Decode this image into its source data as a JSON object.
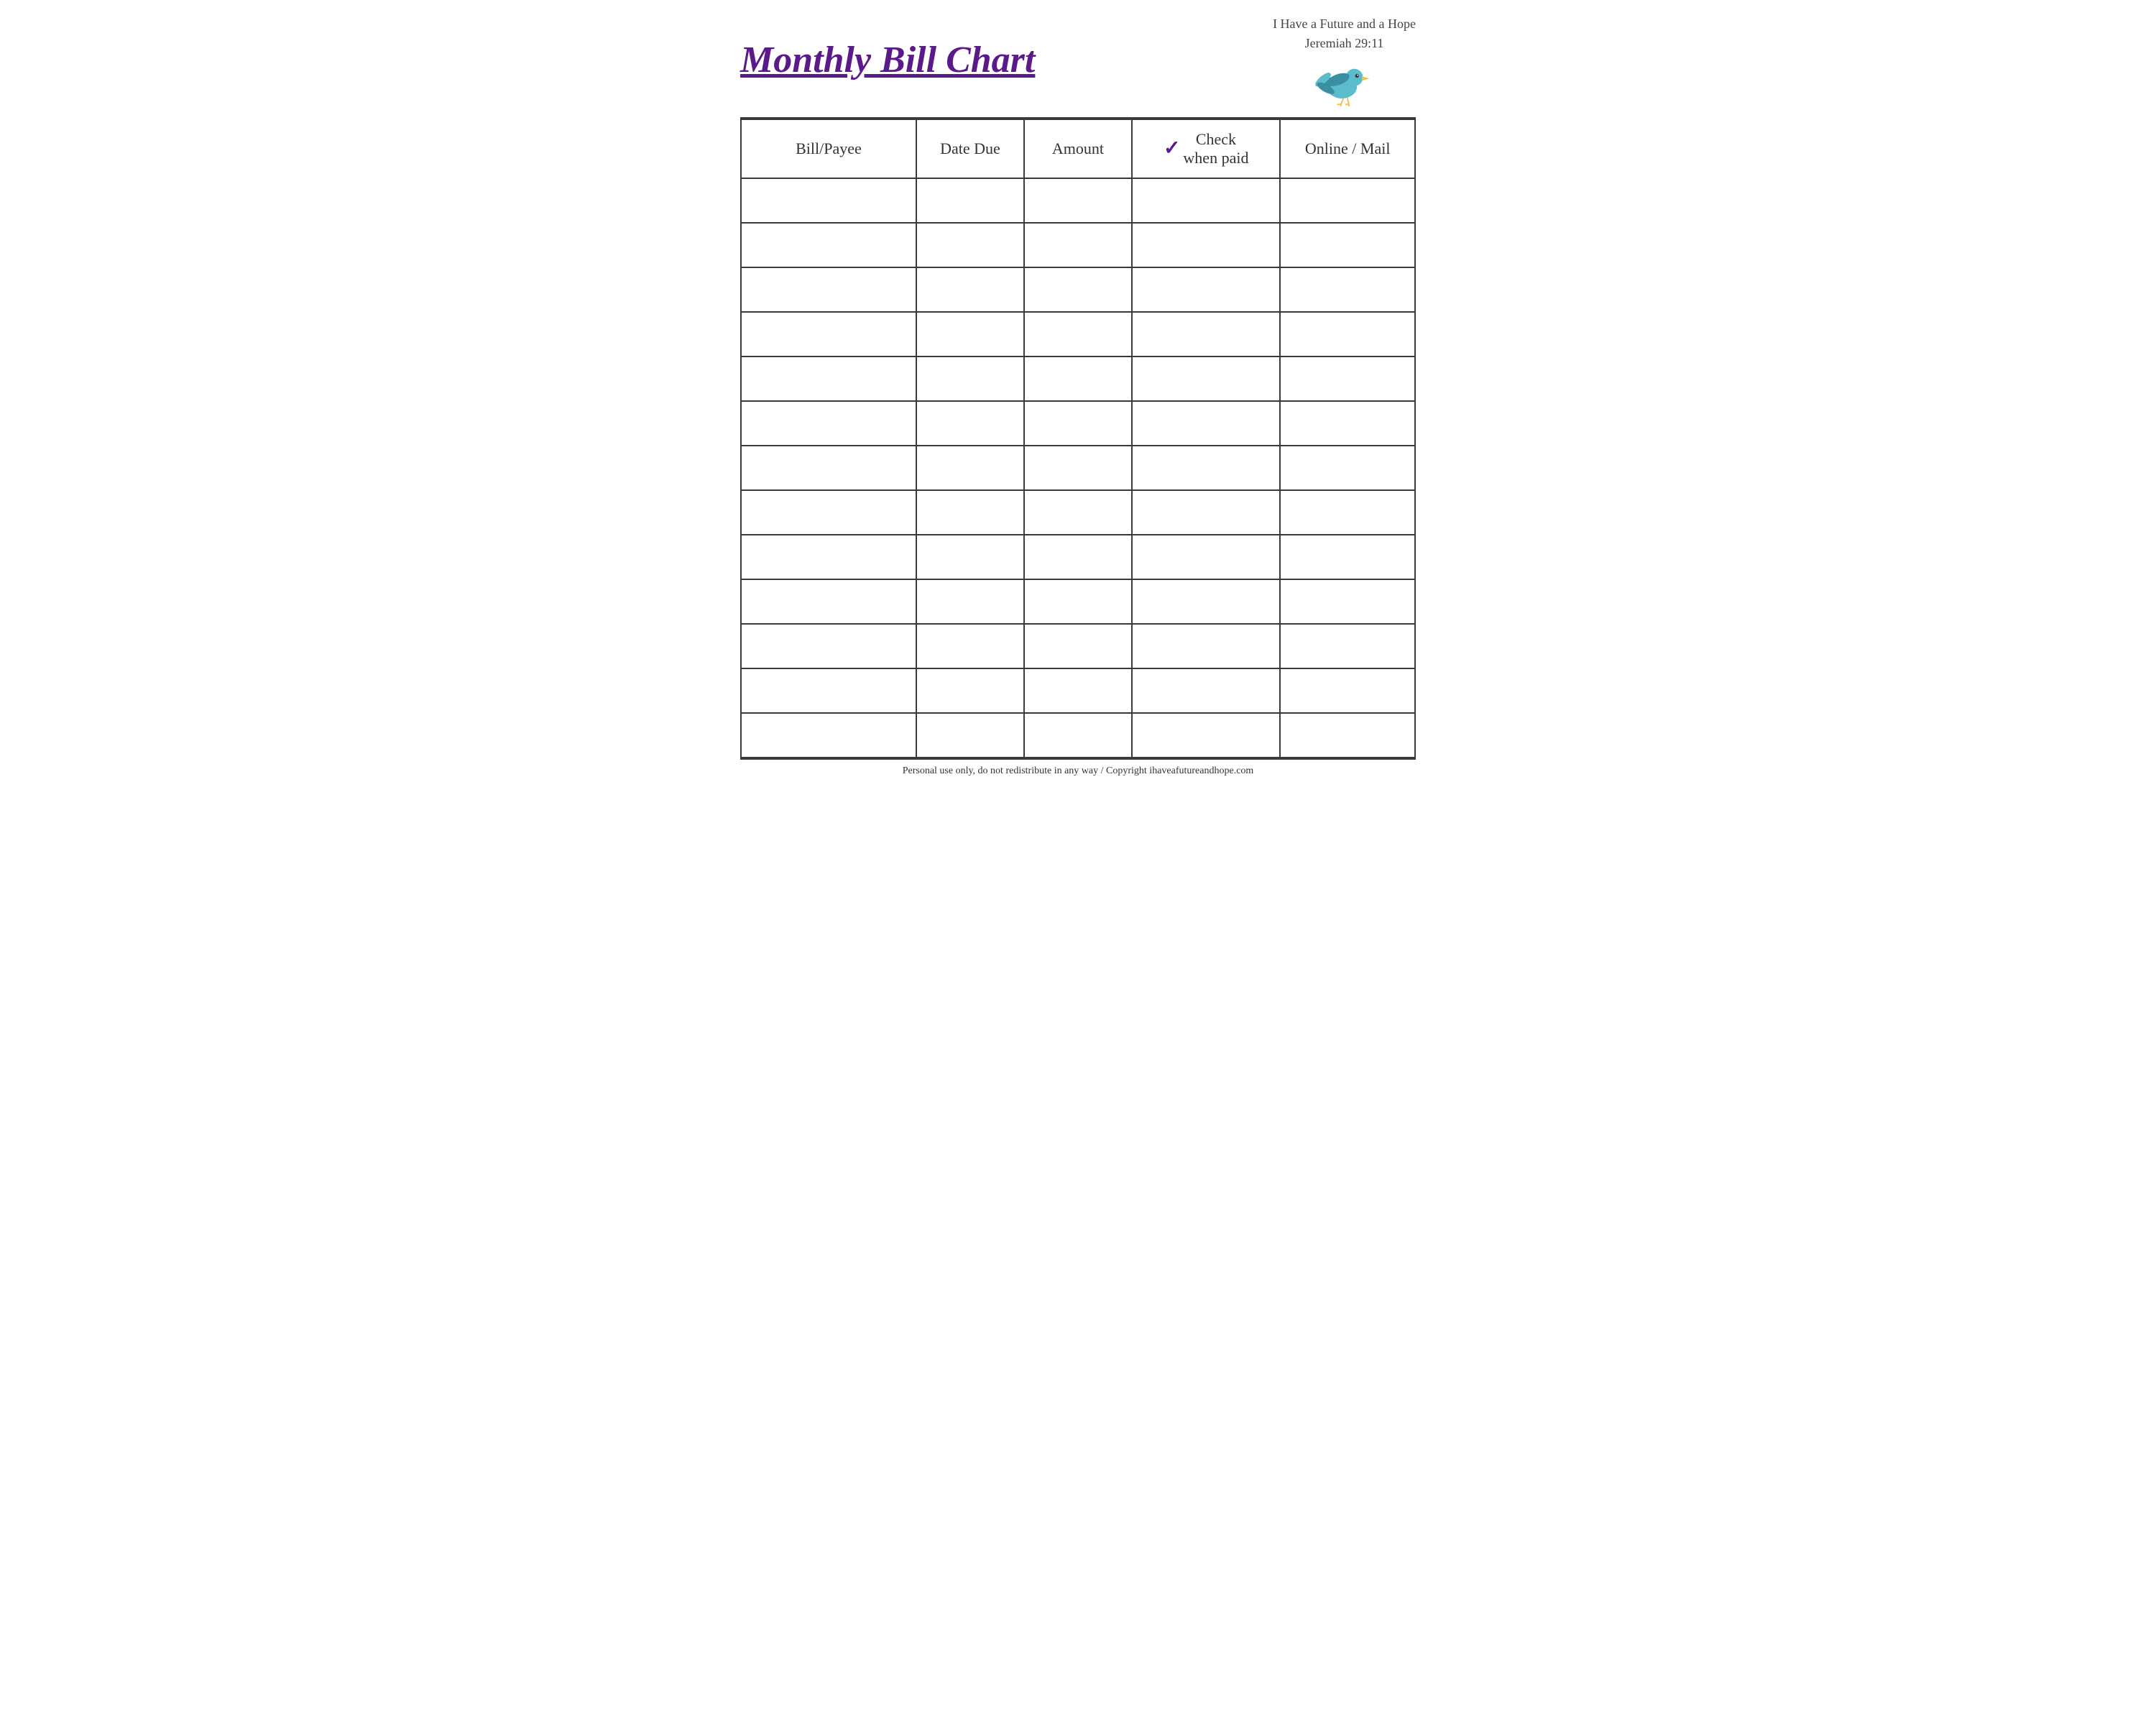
{
  "header": {
    "title": "Monthly Bill Chart",
    "scripture_line1": "I Have a Future and a Hope",
    "scripture_line2": "Jeremiah 29:11"
  },
  "table": {
    "columns": [
      {
        "id": "bill-payee",
        "label": "Bill/Payee"
      },
      {
        "id": "date-due",
        "label": "Date Due"
      },
      {
        "id": "amount",
        "label": "Amount"
      },
      {
        "id": "check-when-paid",
        "label": "Check when paid",
        "has_checkmark": true
      },
      {
        "id": "online-mail",
        "label": "Online / Mail"
      }
    ],
    "row_count": 13
  },
  "footer": {
    "text": "Personal use only, do not redistribute in any way / Copyright ihaveafutureandhope.com"
  },
  "colors": {
    "title": "#5b1a8a",
    "border": "#3a3a3a",
    "check": "#5b1a8a",
    "bird_body": "#5bbccc",
    "bird_wing": "#3a8fa0",
    "bird_beak": "#f0c040",
    "bird_eye": "#333"
  }
}
